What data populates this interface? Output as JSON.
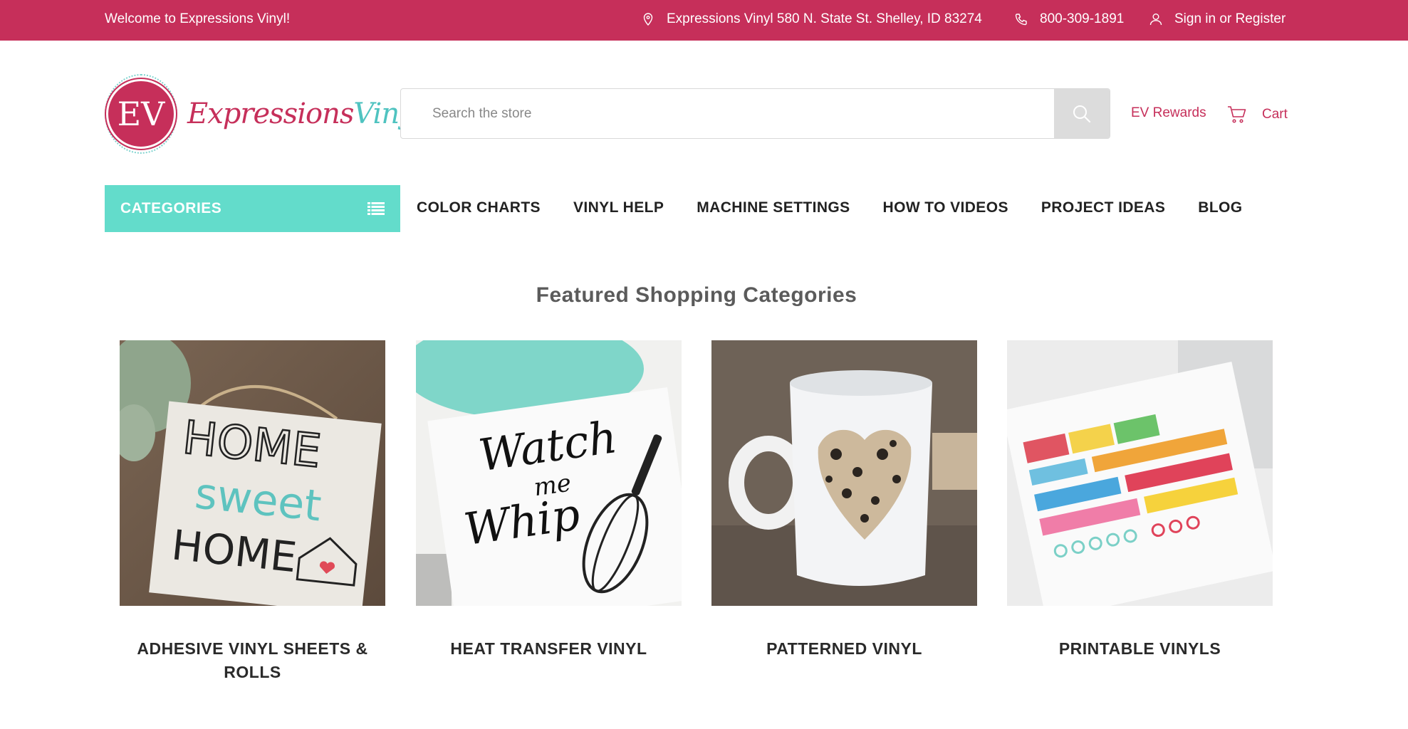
{
  "topbar": {
    "welcome": "Welcome to Expressions Vinyl!",
    "address": "Expressions Vinyl 580 N. State St. Shelley, ID 83274",
    "phone": "800-309-1891",
    "account_sign_in": "Sign in",
    "account_or": "or",
    "account_register": "Register"
  },
  "logo": {
    "mark": "EV",
    "name_part1": "Expressions",
    "name_part2": "Vinyl"
  },
  "search": {
    "placeholder": "Search the store"
  },
  "header": {
    "rewards": "EV Rewards",
    "cart": "Cart"
  },
  "nav": {
    "categories": "CATEGORIES",
    "items": [
      "COLOR CHARTS",
      "VINYL HELP",
      "MACHINE SETTINGS",
      "HOW TO VIDEOS",
      "PROJECT IDEAS",
      "BLOG"
    ]
  },
  "featured": {
    "title": "Featured Shopping Categories",
    "cards": [
      {
        "label": "ADHESIVE VINYL SHEETS & ROLLS",
        "img_text_1": "HOME",
        "img_text_2": "sweet",
        "img_text_3": "HOME"
      },
      {
        "label": "HEAT TRANSFER VINYL",
        "img_text_1": "Watch",
        "img_text_2": "me",
        "img_text_3": "Whip"
      },
      {
        "label": "PATTERNED VINYL"
      },
      {
        "label": "PRINTABLE VINYLS"
      }
    ]
  },
  "colors": {
    "brand_pink": "#c62f5a",
    "brand_teal": "#63dccb"
  }
}
